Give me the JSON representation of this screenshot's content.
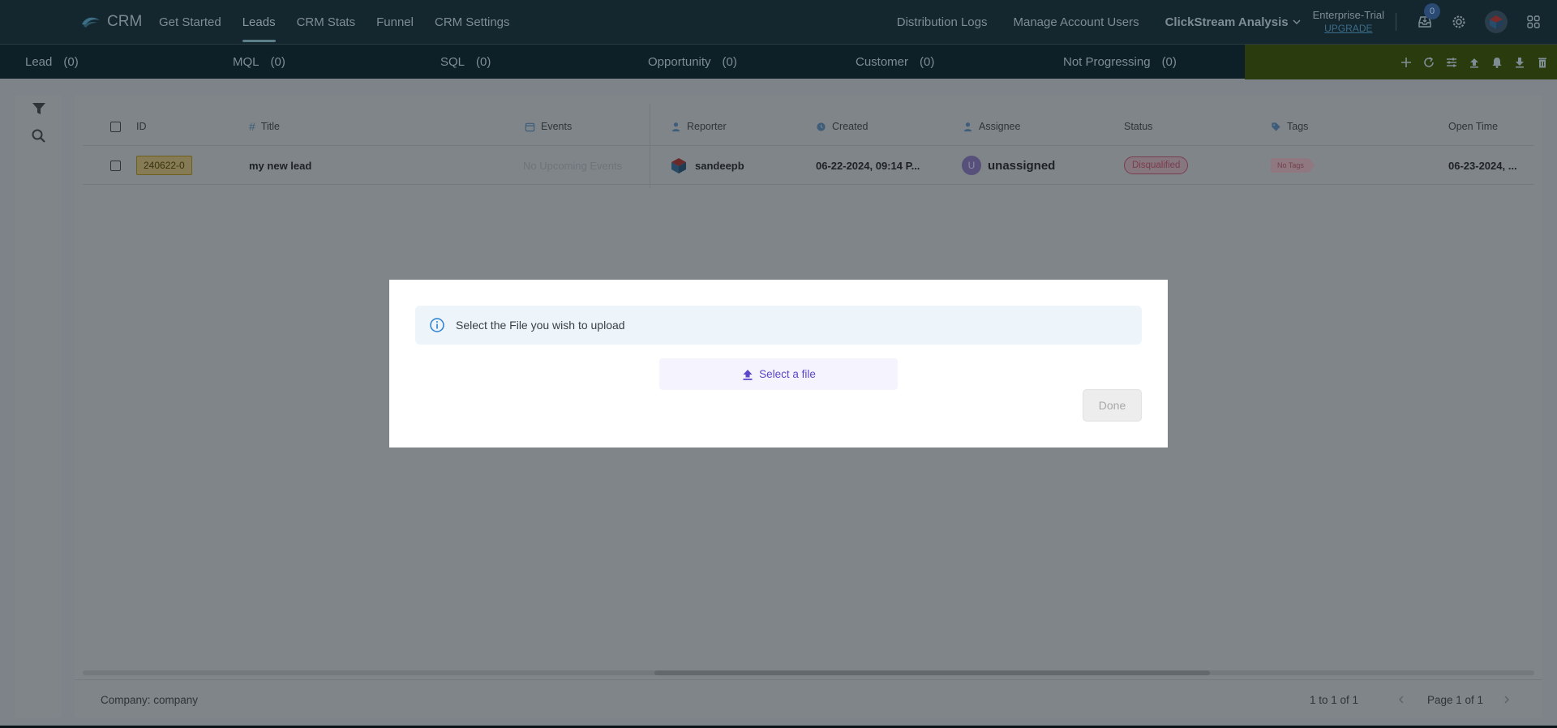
{
  "app": {
    "name": "CRM"
  },
  "nav": {
    "items": [
      {
        "label": "Get Started"
      },
      {
        "label": "Leads"
      },
      {
        "label": "CRM Stats"
      },
      {
        "label": "Funnel"
      },
      {
        "label": "CRM Settings"
      }
    ],
    "active": "Leads",
    "right": {
      "distribution_logs": "Distribution Logs",
      "manage_users": "Manage Account Users",
      "project": "ClickStream Analysis",
      "plan": "Enterprise-Trial",
      "upgrade": "UPGRADE",
      "inbox_count": "0"
    }
  },
  "stages": [
    {
      "label": "Lead",
      "count": "(0)"
    },
    {
      "label": "MQL",
      "count": "(0)"
    },
    {
      "label": "SQL",
      "count": "(0)"
    },
    {
      "label": "Opportunity",
      "count": "(0)"
    },
    {
      "label": "Customer",
      "count": "(0)"
    },
    {
      "label": "Not Progressing",
      "count": "(0)"
    }
  ],
  "table": {
    "columns": {
      "id": "ID",
      "title": "Title",
      "events": "Events",
      "reporter": "Reporter",
      "created": "Created",
      "assignee": "Assignee",
      "status": "Status",
      "tags": "Tags",
      "open_time": "Open Time"
    },
    "rows": [
      {
        "id": "240622-0",
        "title": "my new lead",
        "events": "No Upcoming Events",
        "reporter": "sandeepb",
        "created": "06-22-2024, 09:14 P...",
        "assignee_initial": "U",
        "assignee": "unassigned",
        "status": "Disqualified",
        "tags": "No Tags",
        "open_time": "06-23-2024, ..."
      }
    ]
  },
  "footer": {
    "company": "Company: company",
    "range": "1 to 1 of 1",
    "page": "Page 1 of 1"
  },
  "modal": {
    "message": "Select the File you wish to upload",
    "select_label": "Select a file",
    "done_label": "Done"
  },
  "colors": {
    "accent": "#5b47c7",
    "info": "#2b7fd1",
    "status_disqualified": "#d63b6a"
  }
}
